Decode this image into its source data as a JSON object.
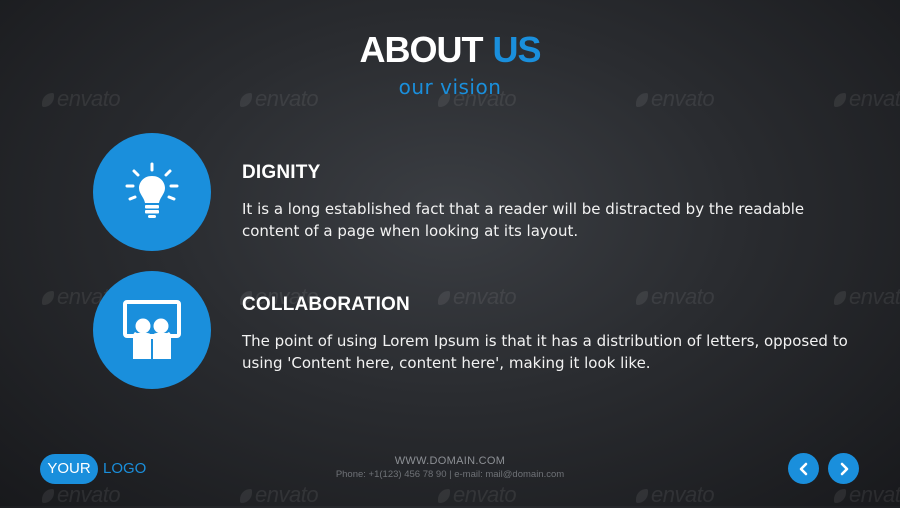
{
  "colors": {
    "accent": "#1a8fdc",
    "background": "#2b2d31"
  },
  "header": {
    "title_part1": "ABOUT",
    "title_part2": "US",
    "subtitle": "our vision"
  },
  "features": [
    {
      "icon": "lightbulb-icon",
      "title": "DIGNITY",
      "description": "It is a long established fact that a reader will be distracted by the readable content of a page when looking at its layout."
    },
    {
      "icon": "presentation-board-icon",
      "title": "COLLABORATION",
      "description": "The point of using Lorem Ipsum is that it has a distribution of letters, opposed to using 'Content here, content here', making it look like."
    }
  ],
  "footer": {
    "logo_your": "YOUR",
    "logo_logo": "LOGO",
    "domain": "WWW.DOMAIN.COM",
    "contact": "Phone: +1(123) 456 78 90 | e-mail: mail@domain.com"
  },
  "navigation": {
    "prev_icon": "chevron-left-icon",
    "next_icon": "chevron-right-icon"
  },
  "watermark": "envato"
}
